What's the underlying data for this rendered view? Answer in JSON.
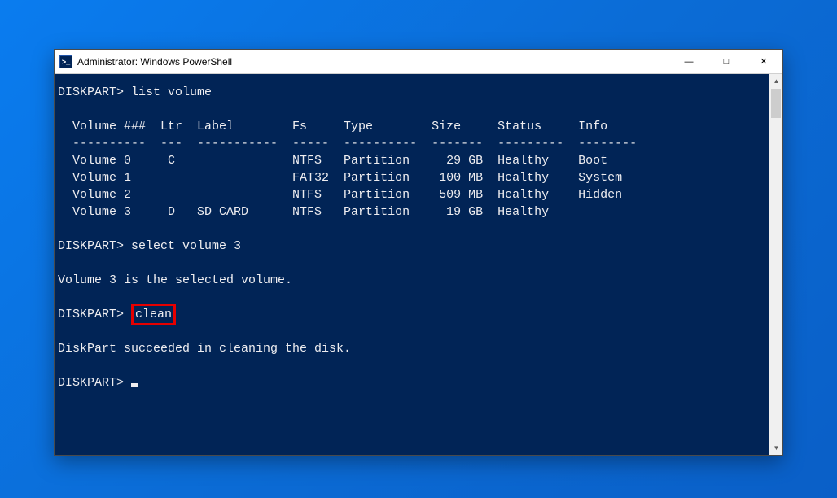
{
  "window": {
    "title": "Administrator: Windows PowerShell",
    "icon_glyph": ">_"
  },
  "terminal": {
    "prompt": "DISKPART>",
    "cmd_list_volume": "list volume",
    "header": "  Volume ###  Ltr  Label        Fs     Type        Size     Status     Info",
    "divider": "  ----------  ---  -----------  -----  ----------  -------  ---------  --------",
    "rows": [
      "  Volume 0     C                NTFS   Partition     29 GB  Healthy    Boot",
      "  Volume 1                      FAT32  Partition    100 MB  Healthy    System",
      "  Volume 2                      NTFS   Partition    509 MB  Healthy    Hidden",
      "  Volume 3     D   SD CARD      NTFS   Partition     19 GB  Healthy"
    ],
    "cmd_select": "select volume 3",
    "msg_selected": "Volume 3 is the selected volume.",
    "cmd_clean": "clean",
    "msg_clean_ok": "DiskPart succeeded in cleaning the disk."
  }
}
